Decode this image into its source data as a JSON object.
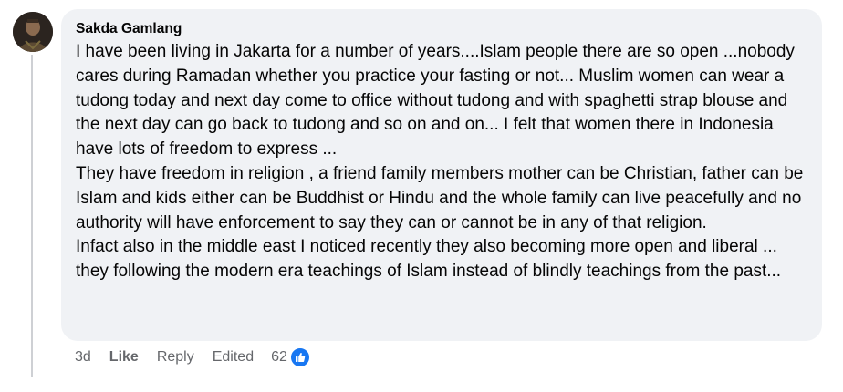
{
  "comment": {
    "author": "Sakda Gamlang",
    "paragraphs": [
      "I have been living in Jakarta for a number of years....Islam people there are so open ...nobody cares during Ramadan whether you practice your fasting or not... Muslim women can wear a tudong today and next day come to office without tudong and with spaghetti strap blouse and the next day can go back to tudong and so on and on... I felt that women there in Indonesia have lots of freedom to express ...",
      "They have freedom in religion , a friend family members mother can be Christian, father can be Islam and kids either can be Buddhist or Hindu and the whole family can live peacefully and no authority will have enforcement to say they can or cannot be in any of that religion.",
      "Infact also in the middle east I noticed recently they also becoming more open and liberal ... they following the modern era teachings of Islam instead of blindly teachings from the past..."
    ]
  },
  "actions": {
    "time": "3d",
    "like": "Like",
    "reply": "Reply",
    "edited": "Edited",
    "reaction_count": "62",
    "reaction_icon": "thumbs-up-icon"
  },
  "colors": {
    "bubble_bg": "#f0f2f5",
    "meta_text": "#65676b",
    "like_blue": "#1877f2",
    "thread_line": "#ced0d4"
  }
}
